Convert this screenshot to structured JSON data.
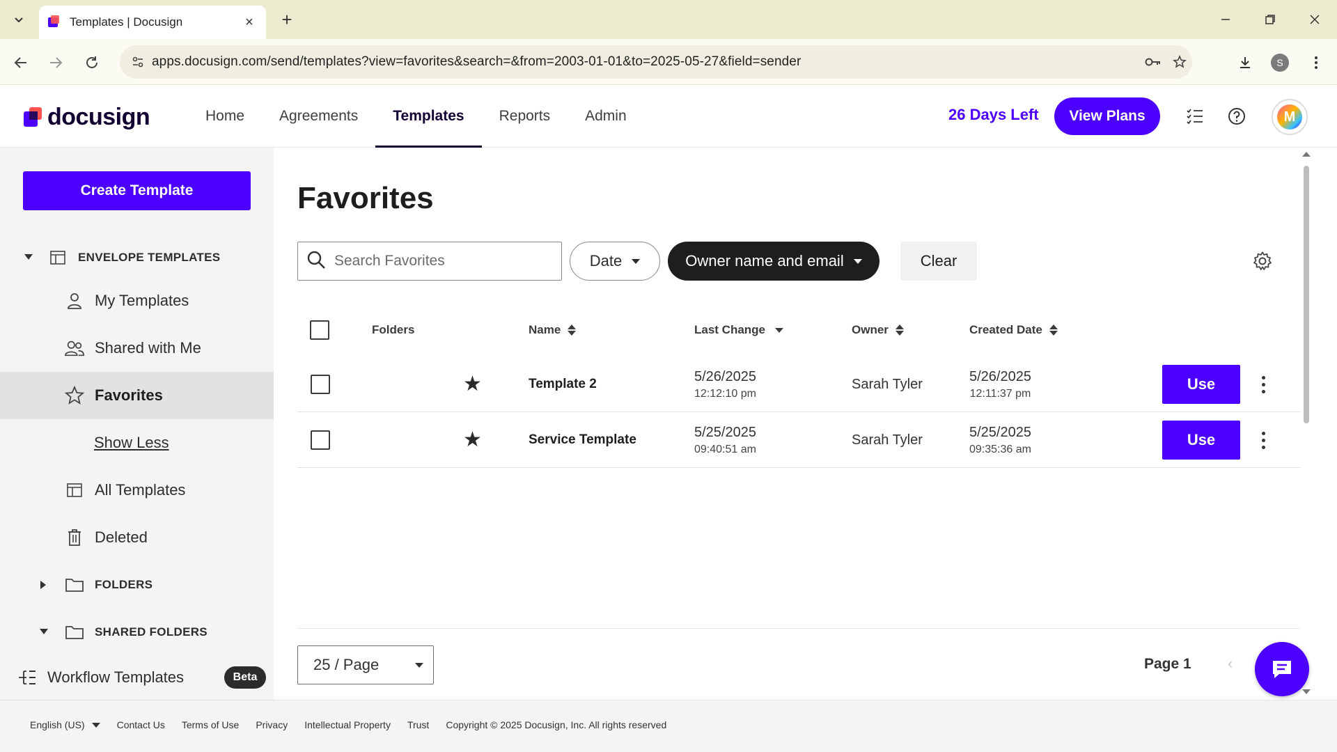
{
  "browser": {
    "tab_title": "Templates | Docusign",
    "url": "apps.docusign.com/send/templates?view=favorites&search=&from=2003-01-01&to=2025-05-27&field=sender",
    "profile_initial": "S"
  },
  "header": {
    "logo_text": "docusign",
    "nav": [
      "Home",
      "Agreements",
      "Templates",
      "Reports",
      "Admin"
    ],
    "active_nav": "Templates",
    "days_left": "26 Days Left",
    "view_plans": "View Plans",
    "avatar_initial": "M"
  },
  "sidebar": {
    "create_button": "Create Template",
    "envelope_templates": "ENVELOPE TEMPLATES",
    "items": [
      "My Templates",
      "Shared with Me",
      "Favorites"
    ],
    "active_item": "Favorites",
    "show_less": "Show Less",
    "all_templates": "All Templates",
    "deleted": "Deleted",
    "folders": "FOLDERS",
    "shared_folders": "SHARED FOLDERS",
    "workflow_templates": "Workflow Templates",
    "beta": "Beta"
  },
  "main": {
    "title": "Favorites",
    "search_placeholder": "Search Favorites",
    "filters": {
      "date": "Date",
      "owner": "Owner name and email",
      "clear": "Clear"
    },
    "columns": {
      "folders": "Folders",
      "name": "Name",
      "last_change": "Last Change",
      "owner": "Owner",
      "created_date": "Created Date"
    },
    "rows": [
      {
        "name": "Template 2",
        "last_change_date": "5/26/2025",
        "last_change_time": "12:12:10 pm",
        "owner": "Sarah Tyler",
        "created_date": "5/26/2025",
        "created_time": "12:11:37 pm",
        "action": "Use"
      },
      {
        "name": "Service Template",
        "last_change_date": "5/25/2025",
        "last_change_time": "09:40:51 am",
        "owner": "Sarah Tyler",
        "created_date": "5/25/2025",
        "created_time": "09:35:36 am",
        "action": "Use"
      }
    ],
    "per_page": "25 / Page",
    "page_label": "Page 1"
  },
  "footer": {
    "language": "English (US)",
    "links": [
      "Contact Us",
      "Terms of Use",
      "Privacy",
      "Intellectual Property",
      "Trust"
    ],
    "copyright": "Copyright © 2025 Docusign, Inc. All rights reserved"
  },
  "colors": {
    "accent": "#4c00ff",
    "dark": "#130032",
    "brand_red": "#ff5252"
  }
}
